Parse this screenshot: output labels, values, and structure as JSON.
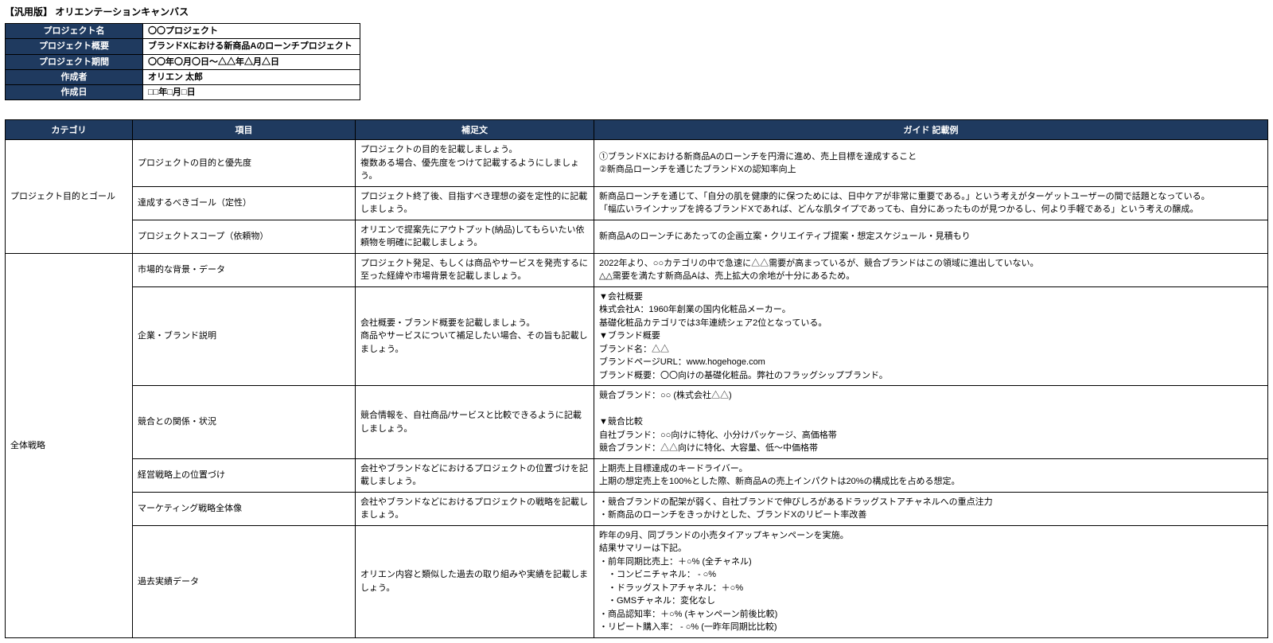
{
  "title": "【汎用版】 オリエンテーションキャンバス",
  "info": {
    "labels": {
      "name": "プロジェクト名",
      "overview": "プロジェクト概要",
      "period": "プロジェクト期間",
      "author": "作成者",
      "date": "作成日"
    },
    "values": {
      "name": "〇〇プロジェクト",
      "overview": "ブランドXにおける新商品Aのローンチプロジェクト",
      "period": "〇〇年〇月〇日〜△△年△月△日",
      "author": "オリエン 太郎",
      "date": "□□年□月□日"
    }
  },
  "headers": {
    "category": "カテゴリ",
    "item": "項目",
    "supplement": "補足文",
    "example": "ガイド 記載例"
  },
  "groups": [
    {
      "category": "プロジェクト目的とゴール",
      "rows": [
        {
          "item": "プロジェクトの目的と優先度",
          "supplement": "プロジェクトの目的を記載しましょう。\n複数ある場合、優先度をつけて記載するようにしましょう。",
          "example": "①ブランドXにおける新商品Aのローンチを円滑に進め、売上目標を達成すること\n②新商品ローンチを通じたブランドXの認知率向上"
        },
        {
          "item": "達成するべきゴール（定性）",
          "supplement": "プロジェクト終了後、目指すべき理想の姿を定性的に記載しましょう。",
          "example": "新商品ローンチを通じて、「自分の肌を健康的に保つためには、日中ケアが非常に重要である。」という考えがターゲットユーザーの間で話題となっている。\n「幅広いラインナップを誇るブランドXであれば、どんな肌タイプであっても、自分にあったものが見つかるし、何より手軽である」という考えの醸成。"
        },
        {
          "item": "プロジェクトスコープ（依頼物）",
          "supplement": "オリエンで提案先にアウトプット(納品)してもらいたい依頼物を明確に記載しましょう。",
          "example": "新商品Aのローンチにあたっての企画立案・クリエイティブ提案・想定スケジュール・見積もり"
        }
      ]
    },
    {
      "category": "全体戦略",
      "rows": [
        {
          "item": "市場的な背景・データ",
          "supplement": "プロジェクト発足、もしくは商品やサービスを発売するに至った経緯や市場背景を記載しましょう。",
          "example": "2022年より、○○カテゴリの中で急速に△△需要が高まっているが、競合ブランドはこの領域に進出していない。\n△△需要を満たす新商品Aは、売上拡大の余地が十分にあるため。"
        },
        {
          "item": "企業・ブランド説明",
          "supplement": "会社概要・ブランド概要を記載しましょう。\n商品やサービスについて補足したい場合、その旨も記載しましょう。",
          "example": "▼会社概要\n株式会社A：1960年創業の国内化粧品メーカー。\n基礎化粧品カテゴリでは3年連続シェア2位となっている。\n▼ブランド概要\nブランド名：△△\nブランドページURL：www.hogehoge.com\nブランド概要：〇〇向けの基礎化粧品。弊社のフラッグシップブランド。"
        },
        {
          "item": "競合との関係・状況",
          "supplement": "競合情報を、自社商品/サービスと比較できるように記載しましょう。",
          "example": "競合ブランド：○○ (株式会社△△)\n\n▼競合比較\n自社ブランド：○○向けに特化、小分けパッケージ、高価格帯\n競合ブランド：△△向けに特化、大容量、低〜中価格帯"
        },
        {
          "item": "経営戦略上の位置づけ",
          "supplement": "会社やブランドなどにおけるプロジェクトの位置づけを記載しましょう。",
          "example": "上期売上目標達成のキードライバー。\n上期の想定売上を100%とした際、新商品Aの売上インパクトは20%の構成比を占める想定。"
        },
        {
          "item": "マーケティング戦略全体像",
          "supplement": "会社やブランドなどにおけるプロジェクトの戦略を記載しましょう。",
          "example": "・競合ブランドの配架が弱く、自社ブランドで伸びしろがあるドラッグストアチャネルへの重点注力\n・新商品のローンチをきっかけとした、ブランドXのリピート率改善"
        },
        {
          "item": "過去実績データ",
          "supplement": "オリエン内容と類似した過去の取り組みや実績を記載しましょう。",
          "example": "昨年の9月、同ブランドの小売タイアップキャンペーンを実施。\n結果サマリーは下記。\n・前年同期比売上：＋○% (全チャネル)\n　・コンビニチャネル： - ○%\n　・ドラッグストアチャネル：＋○%\n　・GMSチャネル：変化なし\n・商品認知率：＋○% (キャンペーン前後比較)\n・リピート購入率： - ○% (一昨年同期比比較)"
        }
      ]
    }
  ]
}
